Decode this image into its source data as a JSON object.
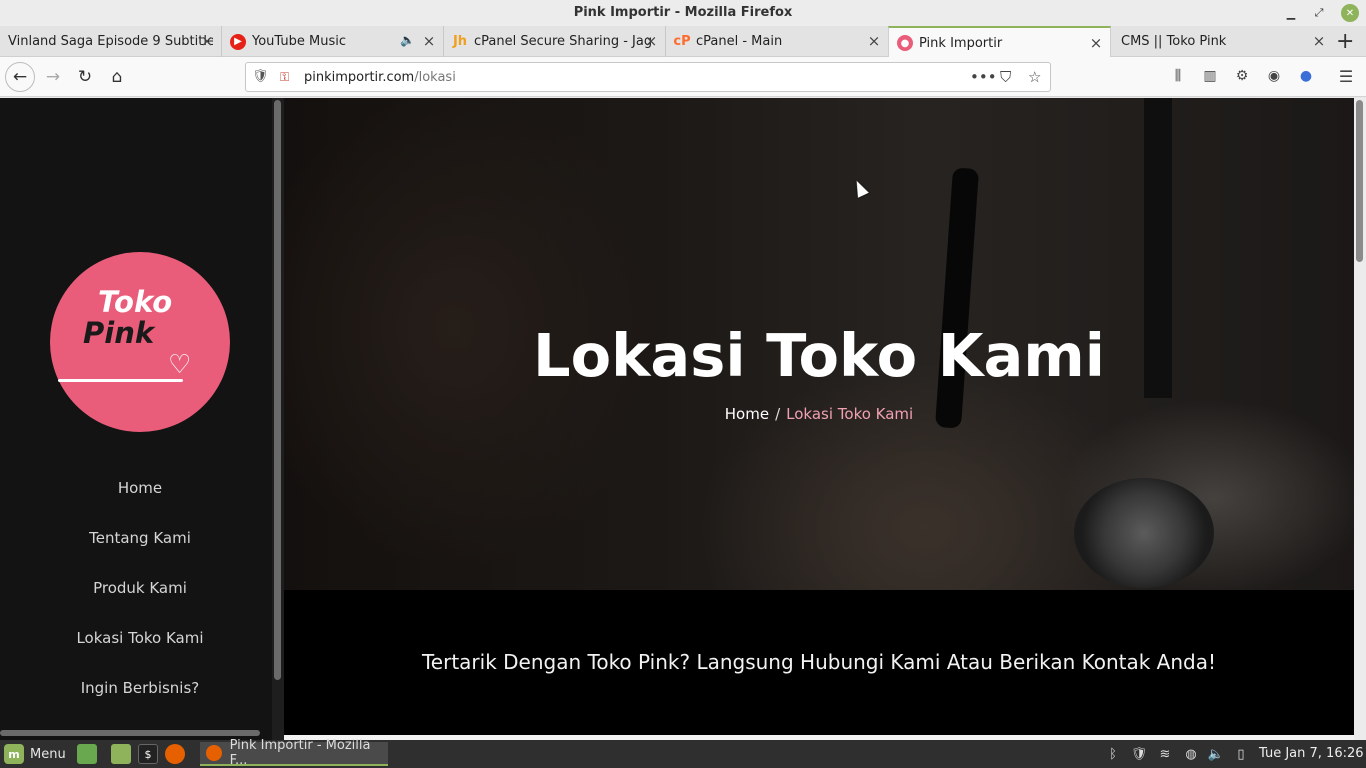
{
  "window": {
    "title": "Pink Importir - Mozilla Firefox"
  },
  "tabs": [
    {
      "label": "Vinland Saga Episode 9 Subtitle",
      "icon": "page-icon"
    },
    {
      "label": "YouTube Music",
      "icon": "youtube-music-icon",
      "audio": "🔈"
    },
    {
      "label": "cPanel Secure Sharing - Jag",
      "icon": "jagoan-icon"
    },
    {
      "label": "cPanel - Main",
      "icon": "cpanel-icon"
    },
    {
      "label": "Pink Importir",
      "icon": "pink-icon",
      "active": true
    },
    {
      "label": "CMS || Toko Pink",
      "icon": "none"
    }
  ],
  "navbar": {
    "url_host": "pinkimportir.com",
    "url_path": "/lokasi"
  },
  "sidebar": {
    "logo": {
      "line1": "Toko",
      "line2": "Pink"
    },
    "items": [
      {
        "label": "Home"
      },
      {
        "label": "Tentang Kami"
      },
      {
        "label": "Produk Kami"
      },
      {
        "label": "Lokasi Toko Kami"
      },
      {
        "label": "Ingin Berbisnis?"
      }
    ]
  },
  "hero": {
    "title": "Lokasi Toko Kami",
    "breadcrumb_home": "Home",
    "breadcrumb_sep": "/",
    "breadcrumb_current": "Lokasi Toko Kami"
  },
  "cta": {
    "text": "Tertarik Dengan Toko Pink? Langsung Hubungi Kami Atau Berikan Kontak Anda!"
  },
  "taskbar": {
    "menu_label": "Menu",
    "task_label": "Pink Importir - Mozilla F...",
    "clock": "Tue Jan  7, 16:26"
  },
  "colors": {
    "brand_pink": "#ea5d7a",
    "accent_green": "#8fb35b",
    "sidebar_bg": "#131313"
  }
}
